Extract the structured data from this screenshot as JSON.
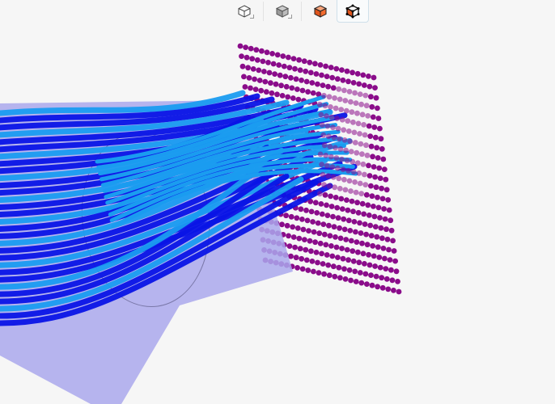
{
  "toolbar": {
    "buttons": [
      {
        "name": "wireframe-view",
        "icon": "cube-outline-icon",
        "active": false,
        "has_menu": true
      },
      {
        "name": "shaded-view",
        "icon": "cube-gray-icon",
        "active": false,
        "has_menu": true
      },
      {
        "name": "solid-orange-view",
        "icon": "cube-orange-icon",
        "active": false,
        "has_menu": false
      },
      {
        "name": "orange-edges-view",
        "icon": "cube-orange-edges-icon",
        "active": true,
        "has_menu": false
      }
    ]
  },
  "scene": {
    "background": "#f6f6f6",
    "pipe_color": "#aaa8ec",
    "plane_dot_color": "#8a0c8a",
    "streamline_dark": "#0a14e6",
    "streamline_light": "#1a9cf0",
    "accent_orange": "#f26b2e"
  }
}
